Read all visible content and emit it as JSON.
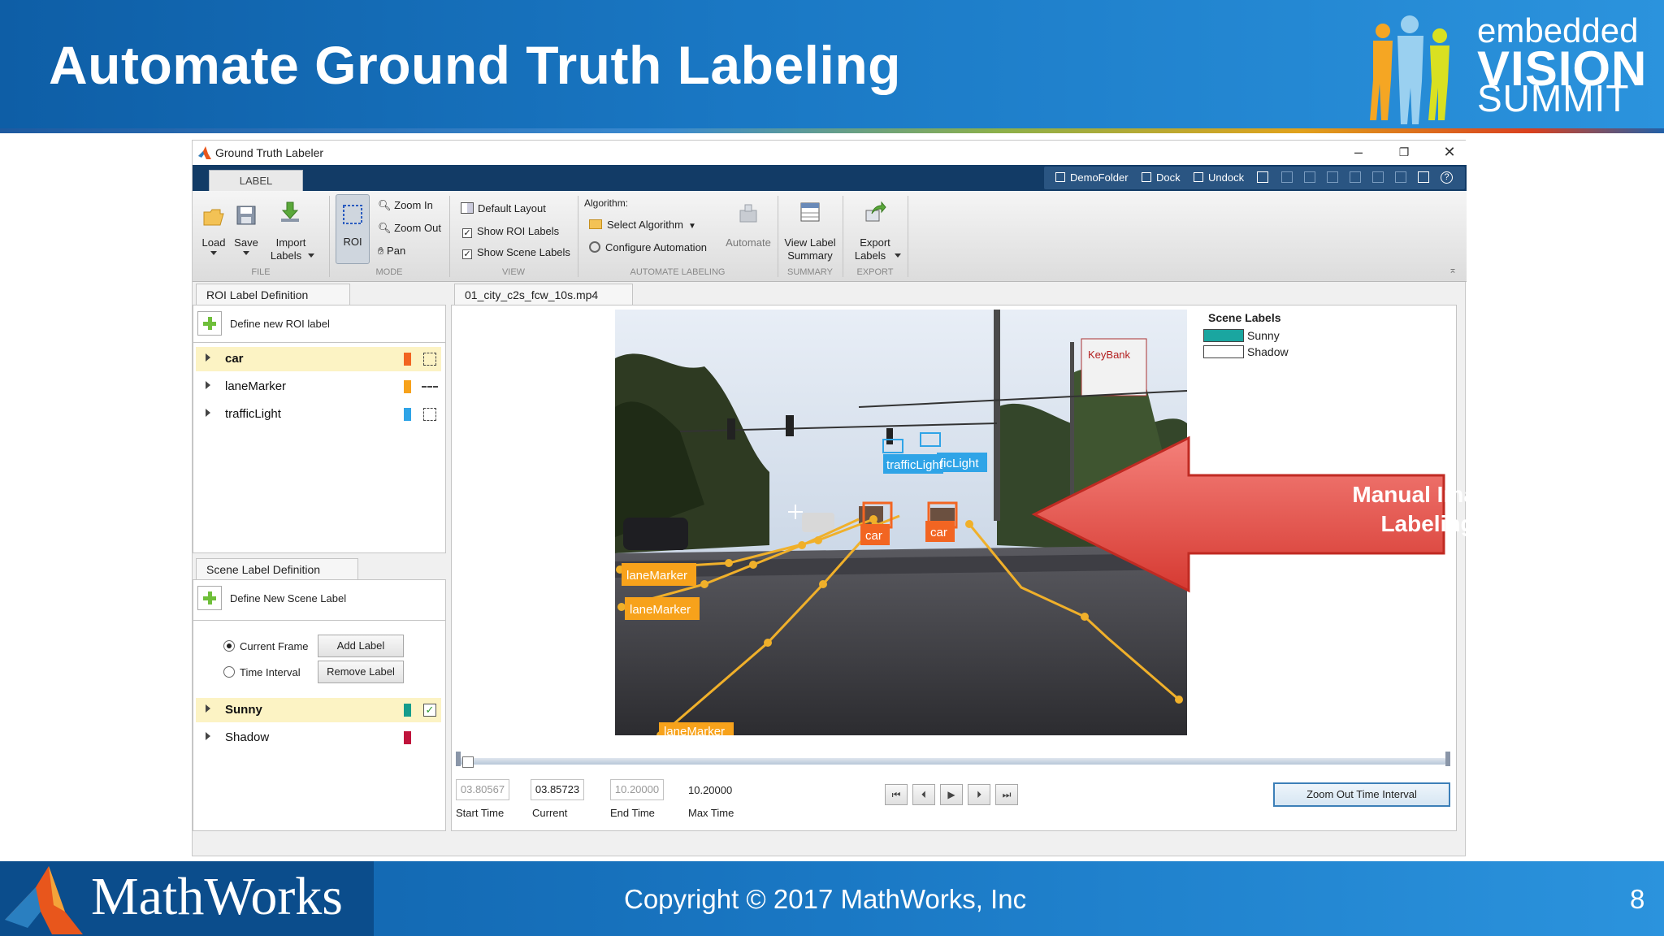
{
  "slide": {
    "title": "Automate Ground Truth Labeling",
    "evs_logo": {
      "line1": "embedded",
      "line2": "VISION",
      "line3": "SUMMIT"
    },
    "footer": {
      "brand": "MathWorks",
      "copyright": "Copyright © 2017 MathWorks, Inc",
      "page_number": "8"
    }
  },
  "window": {
    "title": "Ground Truth Labeler",
    "tab": "LABEL",
    "quick_access": [
      "DemoFolder",
      "Dock",
      "Undock"
    ]
  },
  "ribbon": {
    "file": {
      "group": "FILE",
      "load": "Load",
      "save": "Save",
      "import_line1": "Import",
      "import_line2": "Labels"
    },
    "mode": {
      "group": "MODE",
      "roi": "ROI",
      "zoom_in": "Zoom In",
      "zoom_out": "Zoom Out",
      "pan": "Pan"
    },
    "view": {
      "group": "VIEW",
      "default_layout": "Default Layout",
      "show_roi": "Show ROI Labels",
      "show_scene": "Show Scene Labels"
    },
    "automate": {
      "group": "AUTOMATE LABELING",
      "algorithm_label": "Algorithm:",
      "select_algorithm": "Select Algorithm",
      "configure": "Configure Automation",
      "automate": "Automate"
    },
    "summary": {
      "group": "SUMMARY",
      "line1": "View Label",
      "line2": "Summary"
    },
    "export": {
      "group": "EXPORT",
      "line1": "Export",
      "line2": "Labels"
    }
  },
  "roi_panel": {
    "tab": "ROI Label Definition",
    "define": "Define new ROI label",
    "labels": [
      {
        "name": "car",
        "color": "#f26522",
        "shape": "rectangle"
      },
      {
        "name": "laneMarker",
        "color": "#f7a21b",
        "shape": "line"
      },
      {
        "name": "trafficLight",
        "color": "#2fa4e7",
        "shape": "rectangle"
      }
    ]
  },
  "scene_panel": {
    "tab": "Scene Label Definition",
    "define": "Define New Scene Label",
    "current_frame": "Current Frame",
    "time_interval": "Time Interval",
    "add": "Add Label",
    "remove": "Remove Label",
    "labels": [
      {
        "name": "Sunny",
        "color": "#159c8c"
      },
      {
        "name": "Shadow",
        "color": "#c0143c"
      }
    ]
  },
  "video": {
    "tab": "01_city_c2s_fcw_10s.mp4",
    "scene_legend": {
      "title": "Scene Labels",
      "items": [
        {
          "name": "Sunny",
          "color": "#1aa6a0"
        },
        {
          "name": "Shadow",
          "color": "#ffffff"
        }
      ]
    },
    "overlays": {
      "traffic_light_1": "trafficLight",
      "traffic_light_2": "ficLight",
      "car_1": "car",
      "car_2": "car",
      "lane_1": "laneMarker",
      "lane_2": "laneMarker",
      "lane_3": "laneMarker",
      "store_sign": "KeyBank"
    },
    "callout_line1": "Manual Image",
    "callout_line2": "Labeling"
  },
  "time": {
    "start_value": "03.80567",
    "start_label": "Start Time",
    "current_value": "03.85723",
    "current_label": "Current",
    "end_value": "10.20000",
    "end_label": "End Time",
    "max_value": "10.20000",
    "max_label": "Max Time",
    "zoom_out": "Zoom Out Time Interval"
  }
}
